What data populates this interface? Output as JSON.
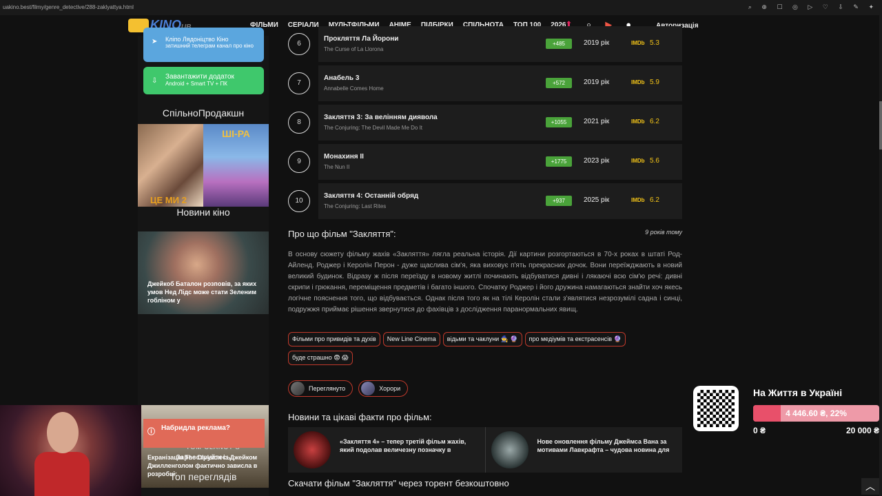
{
  "browser": {
    "url": "uakino.best/filmy/genre_detective/288-zaklyattya.html"
  },
  "header": {
    "logo_text": "KINO",
    "logo_suffix": "UB",
    "menu": [
      "ФІЛЬМИ",
      "СЕРІАЛИ",
      "МУЛЬТФІЛЬМИ",
      "АНІМЕ",
      "ПІДБІРКИ",
      "СПІЛЬНОТА",
      "ТОП 100",
      "2026"
    ],
    "auth_label": "Авторизація"
  },
  "sidebar": {
    "telegram": {
      "title": "Кліпо Лядоніцтво Кіно",
      "subtitle": "затишний телеграм канал про кіно"
    },
    "app": {
      "title": "Завантажити додаток",
      "subtitle": "Android + Smart TV + ПК"
    },
    "section_title": "СпільноПродакшн",
    "promo_right_text": "ШІ-РА",
    "promo_left_text": "ЦЕ МИ 2",
    "news_title": "Новини кіно",
    "news": [
      {
        "caption": "Джейкоб Баталон розповів, за яких умов Нед Лідс може стати Зеленим гобліном у"
      },
      {
        "caption": "Екранізація The Division із Джейком Джилленголом фактично зависла в розробці:",
        "overlay": "TOM CLANCY'S"
      }
    ],
    "ad_label": "Набридла реклама?",
    "register_label": "Зареєструйтесь",
    "top_views_title": "Топ переглядів"
  },
  "franchise": [
    {
      "rank": "6",
      "title": "Прокляття Ла Йорони",
      "original": "The Curse of La Llorona",
      "votes": "+485",
      "year": "2019 рік",
      "imdb": "5.3"
    },
    {
      "rank": "7",
      "title": "Анабель 3",
      "original": "Annabelle Comes Home",
      "votes": "+572",
      "year": "2019 рік",
      "imdb": "5.9"
    },
    {
      "rank": "8",
      "title": "Закляття 3: За велінням диявола",
      "original": "The Conjuring: The Devil Made Me Do It",
      "votes": "+1055",
      "year": "2021 рік",
      "imdb": "6.2"
    },
    {
      "rank": "9",
      "title": "Монахиня II",
      "original": "The Nun II",
      "votes": "+1775",
      "year": "2023 рік",
      "imdb": "5.6"
    },
    {
      "rank": "10",
      "title": "Закляття 4: Останній обряд",
      "original": "The Conjuring: Last Rites",
      "votes": "+937",
      "year": "2025 рік",
      "imdb": "6.2"
    }
  ],
  "imdb_label": "IMDb",
  "about": {
    "heading": "Про що фільм \"Закляття\":",
    "ago": "9 років тому",
    "text": "В основу сюжету фільму жахів «Закляття» лягла реальна історія. Дії картини розгортаються в 70-х роках в штаті Род-Айленд. Роджер і Керолін Перон - дуже щаслива сім'я, яка виховує п'ять прекрасних дочок. Вони переїжджають в новий великий будинок. Відразу ж після переїзду в новому житлі починають відбуватися дивні і лякаючі всю сім'ю речі: дивні скрипи і грюкання, переміщення предметів і багато іншого. Спочатку Роджер і його дружина намагаються знайти хоч якесь логічне пояснення того, що відбувається. Однак після того як на тілі Керолін стали з'являтися незрозумілі садна і синці, подружжя приймає рішення звернутися до фахівців з дослідження паранормальних явищ."
  },
  "tags": [
    "Фільми про привидів та духів",
    "New Line Cinema",
    "відьми та чаклуни 🧙 🔮",
    "про медіумів та екстрасенсів 🔮",
    "буде страшно 😨 😱"
  ],
  "pills": [
    "Переглянуто",
    "Хорори"
  ],
  "facts": {
    "heading": "Новини та цікаві факти про фільм:",
    "items": [
      "«Закляття 4» – тепер третій фільм жахів, який подолав величезну позначку в",
      "Нове оновлення фільму Джеймса Вана за мотивами Лавкрафта – чудова новина для"
    ]
  },
  "download_heading": "Скачати фільм \"Закляття\" через торент безкоштовно",
  "donation": {
    "title": "На Життя в Україні",
    "value": "4 446.60 ₴, 22%",
    "progress_percent": 22,
    "min": "0 ₴",
    "max": "20 000 ₴"
  },
  "colors": {
    "accent": "#c0392b",
    "votes": "#4aa33a",
    "imdb": "#f5c518",
    "telegram": "#5ba6de",
    "app": "#3fc86c"
  }
}
